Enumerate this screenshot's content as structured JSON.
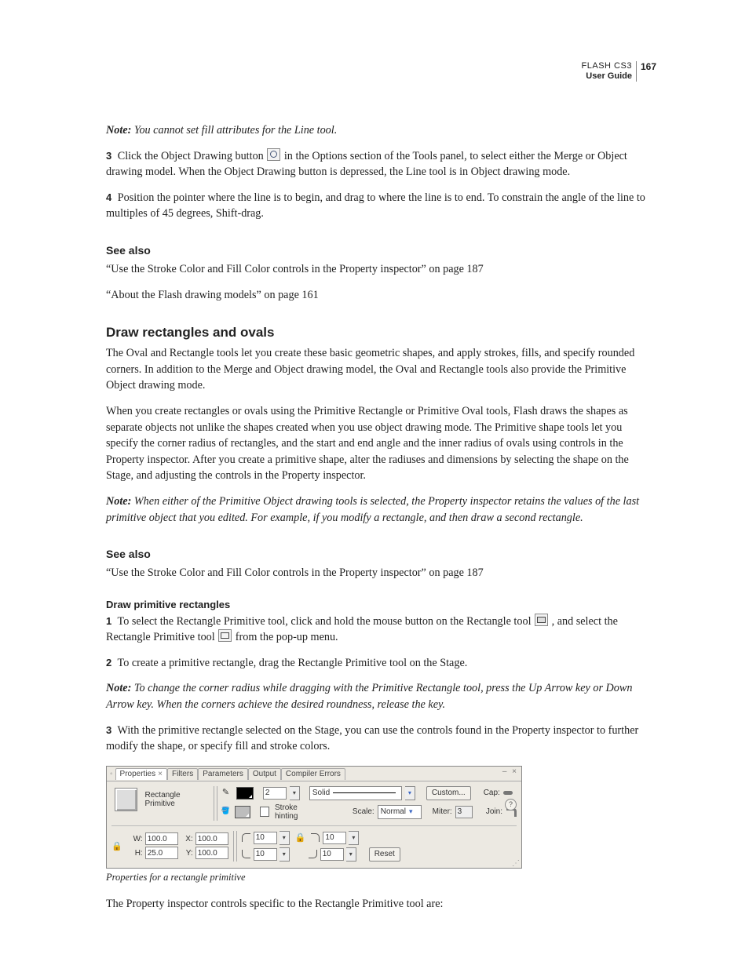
{
  "header": {
    "product": "FLASH CS3",
    "guide": "User Guide",
    "page": "167"
  },
  "p_note1_label": "Note:",
  "p_note1_body": " You cannot set fill attributes for the Line tool.",
  "step3_num": "3",
  "step3_a": "Click the Object Drawing button ",
  "step3_b": " in the Options section of the Tools panel, to select either the Merge or Object drawing model. When the Object Drawing button is depressed, the Line tool is in Object drawing mode.",
  "step4_num": "4",
  "step4": "Position the pointer where the line is to begin, and drag to where the line is to end. To constrain the angle of the line to multiples of 45 degrees, Shift-drag.",
  "seealso1_h": "See also",
  "seealso1_a": "“Use the Stroke Color and Fill Color controls in the Property inspector” on page 187",
  "seealso1_b": "“About the Flash drawing models” on page 161",
  "h2": "Draw rectangles and ovals",
  "para1": "The Oval and Rectangle tools let you create these basic geometric shapes, and apply strokes, fills, and specify rounded corners. In addition to the Merge and Object drawing model, the Oval and Rectangle tools also provide the Primitive Object drawing mode.",
  "para2": "When you create rectangles or ovals using the Primitive Rectangle or Primitive Oval tools, Flash draws the shapes as separate objects not unlike the shapes created when you use object drawing mode. The Primitive shape tools let you specify the corner radius of rectangles, and the start and end angle and the inner radius of ovals using controls in the Property inspector. After you create a primitive shape, alter the radiuses and dimensions by selecting the shape on the Stage, and adjusting the controls in the Property inspector.",
  "p_note2_label": "Note:",
  "p_note2_body": " When either of the Primitive Object drawing tools is selected, the Property inspector retains the values of the last primitive object that you edited. For example, if you modify a rectangle, and then draw a second rectangle.",
  "seealso2_h": "See also",
  "seealso2_a": "“Use the Stroke Color and Fill Color controls in the Property inspector” on page 187",
  "h4": "Draw primitive rectangles",
  "s1_num": "1",
  "s1_a": "To select the Rectangle Primitive tool, click and hold the mouse button on the Rectangle tool ",
  "s1_b": " , and select the Rectangle Primitive tool ",
  "s1_c": " from the pop-up menu.",
  "s2_num": "2",
  "s2": "To create a primitive rectangle, drag the Rectangle Primitive tool on the Stage.",
  "p_note3_label": "Note:",
  "p_note3_body": " To change the corner radius while dragging with the Primitive Rectangle tool, press the Up Arrow key or Down Arrow key. When the corners achieve the desired roundness, release the key.",
  "s3_num": "3",
  "s3": "With the primitive rectangle selected on the Stage, you can use the controls found in the Property inspector to further modify the shape, or specify fill and stroke colors.",
  "fig": {
    "tabs": {
      "properties": "Properties",
      "filters": "Filters",
      "parameters": "Parameters",
      "output": "Output",
      "compiler": "Compiler Errors"
    },
    "tool_label": "Rectangle Primitive",
    "stroke_w": "2",
    "style": "Solid",
    "custom": "Custom...",
    "cap": "Cap:",
    "stroke_hinting": "Stroke hinting",
    "scale_lbl": "Scale:",
    "scale_val": "Normal",
    "miter_lbl": "Miter:",
    "miter_val": "3",
    "join": "Join:",
    "W_lbl": "W:",
    "W": "100.0",
    "X_lbl": "X:",
    "X": "100.0",
    "H_lbl": "H:",
    "H": "25.0",
    "Y_lbl": "Y:",
    "Y": "100.0",
    "corner": "10",
    "reset": "Reset"
  },
  "caption": "Properties for a rectangle primitive",
  "after_fig": "The Property inspector controls specific to the Rectangle Primitive tool are:"
}
